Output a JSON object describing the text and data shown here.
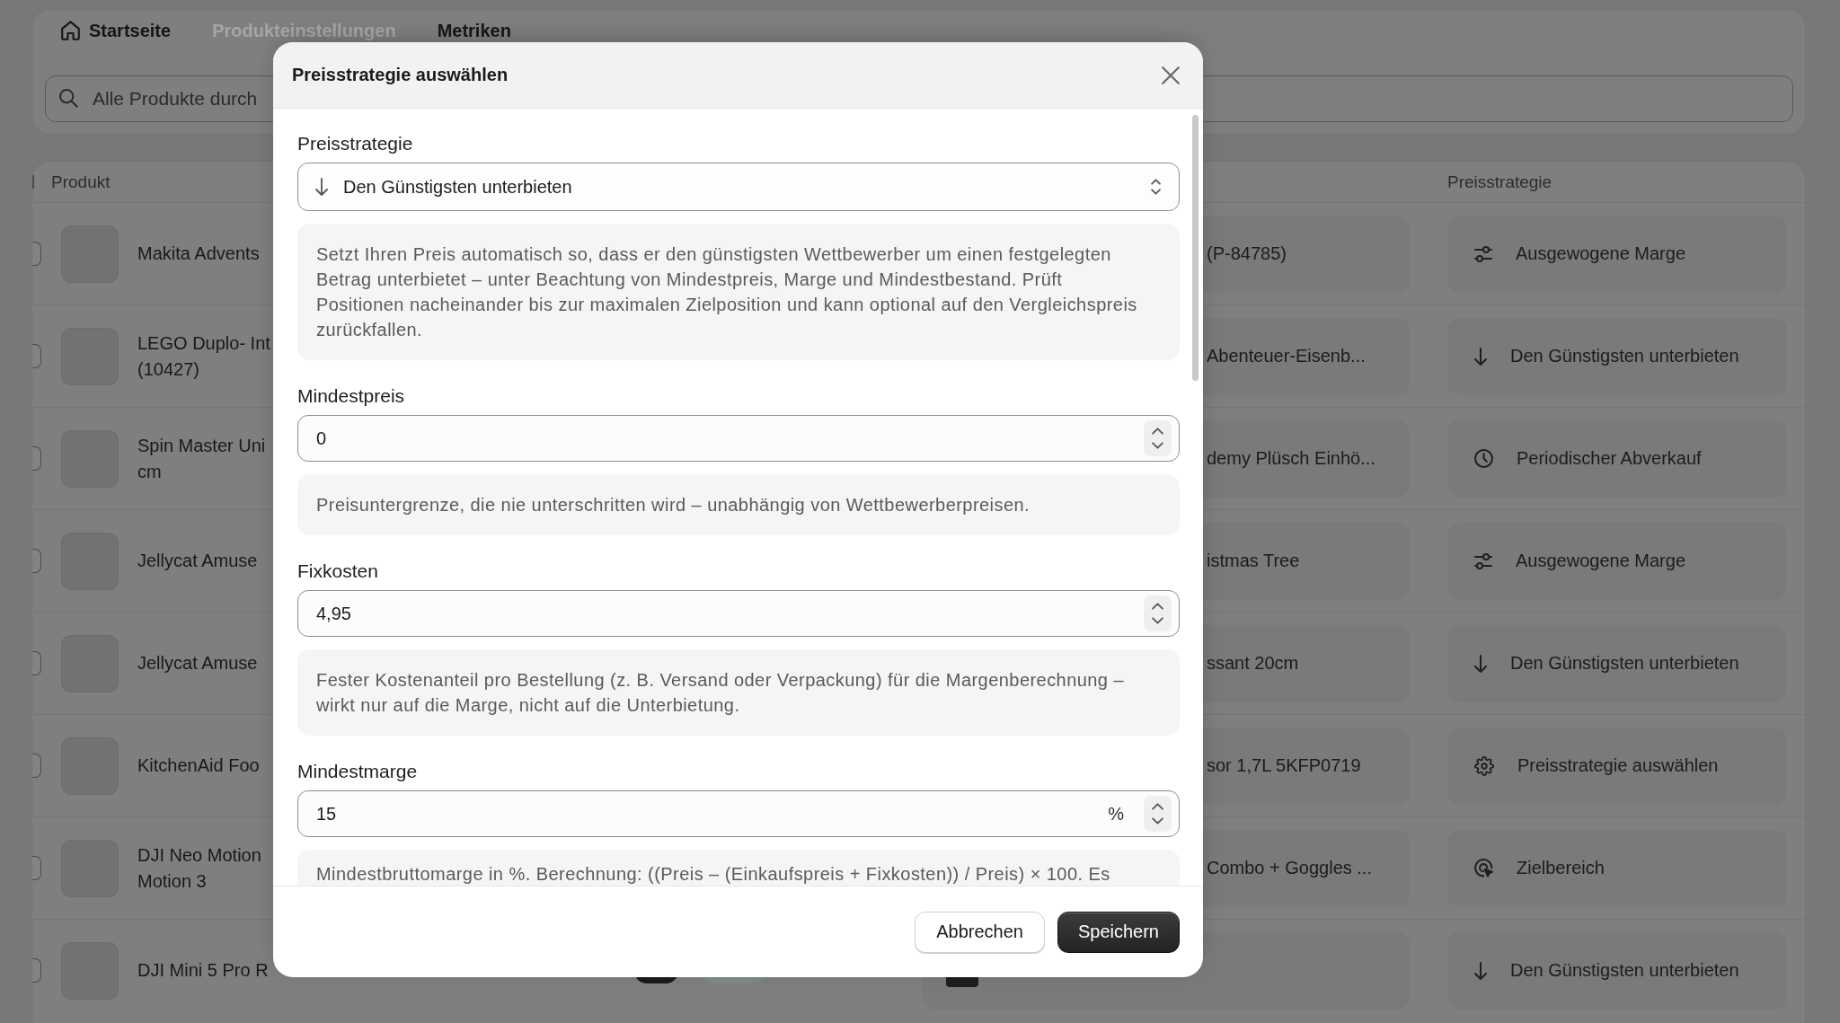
{
  "tabs": [
    {
      "label": "Startseite",
      "kind": "home",
      "disabled": false
    },
    {
      "label": "Produkteinstellungen",
      "kind": "plain",
      "disabled": true
    },
    {
      "label": "Metriken",
      "kind": "plain",
      "disabled": false
    }
  ],
  "search": {
    "placeholder": "Alle Produkte durch"
  },
  "table": {
    "columns": [
      "Produkt",
      "Preisstrategie"
    ],
    "rows": [
      {
        "checked": false,
        "name_lines": [
          "Makita Advents"
        ],
        "listing": "(P-84785)",
        "strategy": {
          "kind": "balanced",
          "label": "Ausgewogene Marge"
        }
      },
      {
        "checked": false,
        "name_lines": [
          "LEGO Duplo- Int",
          "(10427)"
        ],
        "listing": "Abenteuer-Eisenb...",
        "strategy": {
          "kind": "undercut",
          "label": "Den Günstigsten unterbieten"
        }
      },
      {
        "checked": false,
        "name_lines": [
          "Spin Master Uni",
          "cm"
        ],
        "listing": "demy Plüsch Einhö...",
        "strategy": {
          "kind": "periodic",
          "label": "Periodischer Abverkauf"
        }
      },
      {
        "checked": false,
        "name_lines": [
          "Jellycat Amuse"
        ],
        "listing": "istmas Tree",
        "strategy": {
          "kind": "balanced",
          "label": "Ausgewogene Marge"
        }
      },
      {
        "checked": false,
        "name_lines": [
          "Jellycat Amuse"
        ],
        "listing": "ssant 20cm",
        "strategy": {
          "kind": "undercut",
          "label": "Den Günstigsten unterbieten"
        }
      },
      {
        "checked": false,
        "name_lines": [
          "KitchenAid Foo"
        ],
        "listing": "sor 1,7L 5KFP0719",
        "strategy": {
          "kind": "unset",
          "label": "Preisstrategie auswählen"
        }
      },
      {
        "checked": false,
        "name_lines": [
          "DJI Neo Motion",
          "Motion 3"
        ],
        "listing": "Combo + Goggles ...",
        "strategy": {
          "kind": "target",
          "label": "Zielbereich"
        }
      },
      {
        "checked": false,
        "name_lines": [
          "DJI Mini 5 Pro R"
        ],
        "tags": [
          {
            "color": "#1b1b1b"
          },
          {
            "color": "#7e8b85"
          }
        ],
        "listing_photo": true,
        "strategy": {
          "kind": "undercut",
          "label": "Den Günstigsten unterbieten"
        }
      }
    ]
  },
  "modal": {
    "title": "Preisstrategie auswählen",
    "fields": [
      {
        "kind": "select",
        "label": "Preisstrategie",
        "option": {
          "kind": "undercut",
          "label": "Den Günstigsten unterbieten"
        },
        "help": "Setzt Ihren Preis automatisch so, dass er den günstigsten Wettbewerber um einen festgelegten Betrag unterbietet – unter Beachtung von Mindestpreis, Marge und Mindestbestand. Prüft Positionen nacheinander bis zur maximalen Zielposition und kann optional auf den Vergleichspreis zurückfallen."
      },
      {
        "kind": "number",
        "label": "Mindestpreis",
        "value": "0",
        "help": "Preisuntergrenze, die nie unterschritten wird – unabhängig von Wettbewerberpreisen."
      },
      {
        "kind": "number",
        "label": "Fixkosten",
        "value": "4,95",
        "help": "Fester Kostenanteil pro Bestellung (z. B. Versand oder Verpackung) für die Margenberechnung – wirkt nur auf die Marge, nicht auf die Unterbietung."
      },
      {
        "kind": "number",
        "label": "Mindestmarge",
        "value": "15",
        "suffix": "%",
        "help": "Mindestbruttomarge in %. Berechnung: ((Preis – (Einkaufspreis + Fixkosten)) / Preis) × 100. Es"
      }
    ],
    "buttons": [
      {
        "kind": "secondary",
        "label": "Abbrechen"
      },
      {
        "kind": "primary",
        "label": "Speichern"
      }
    ]
  }
}
